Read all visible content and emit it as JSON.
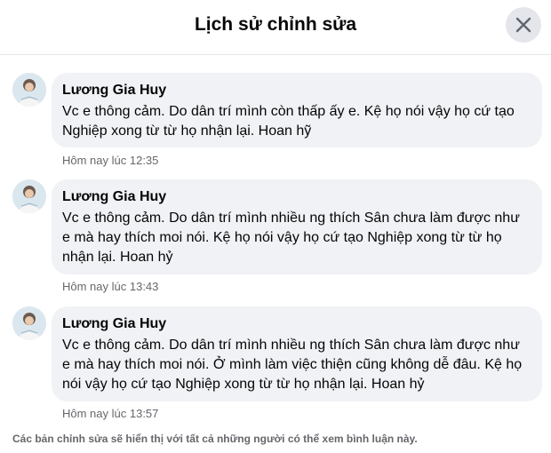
{
  "dialog": {
    "title": "Lịch sử chỉnh sửa",
    "close_icon": "close-icon"
  },
  "edits": [
    {
      "author": "Lương Gia Huy",
      "text": "Vc e thông cảm. Do dân trí mình còn thấp ấy e. Kệ họ nói vậy họ cứ tạo Nghiệp xong từ từ họ nhận lại. Hoan hỹ",
      "timestamp": "Hôm nay lúc 12:35"
    },
    {
      "author": "Lương Gia Huy",
      "text": "Vc e thông cảm. Do dân trí mình nhiều ng thích Sân chưa làm được như e mà hay thích moi nói. Kệ họ nói vậy họ cứ tạo Nghiệp xong từ từ họ nhận lại. Hoan hỷ",
      "timestamp": "Hôm nay lúc 13:43"
    },
    {
      "author": "Lương Gia Huy",
      "text": "Vc e thông cảm. Do dân trí mình nhiều ng thích Sân chưa làm được như e mà hay thích moi nói. Ở mình làm việc thiện cũng không dễ đâu. Kệ họ nói vậy họ cứ tạo Nghiệp xong từ từ họ nhận lại. Hoan hỷ",
      "timestamp": "Hôm nay lúc 13:57"
    }
  ],
  "footer": {
    "note": "Các bản chỉnh sửa sẽ hiển thị với tất cả những người có thể xem bình luận này."
  },
  "colors": {
    "bubble_bg": "#f0f2f5",
    "secondary_text": "#65676b",
    "close_bg": "#e4e6eb"
  }
}
